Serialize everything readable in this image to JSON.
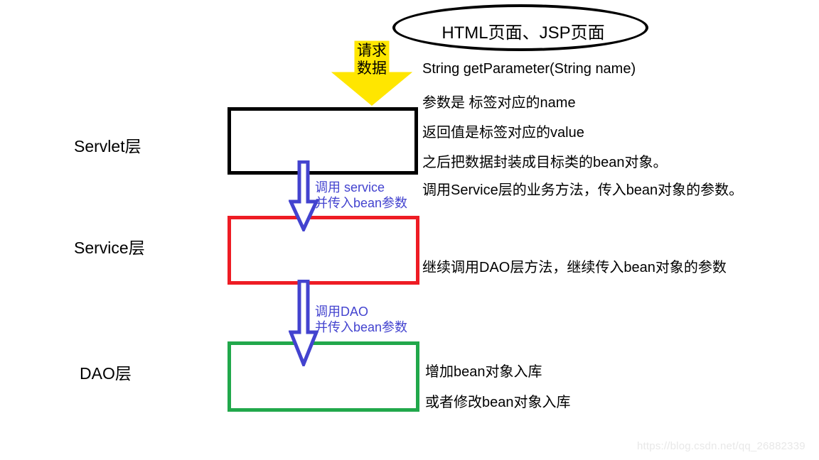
{
  "diagram": {
    "title_ellipse": {
      "label": "HTML页面、JSP页面",
      "icon": "ellipse-shape",
      "border_color": "#000000"
    },
    "request_arrow": {
      "icon": "down-arrow-icon",
      "fill_color": "#ffe600",
      "line1": "请求",
      "line2": "数据"
    },
    "layers": [
      {
        "name": "servlet",
        "label": "Servlet层",
        "box_color": "#000000"
      },
      {
        "name": "service",
        "label": "Service层",
        "box_color": "#ee1c24"
      },
      {
        "name": "dao",
        "label": "DAO层",
        "box_color": "#21a84b"
      }
    ],
    "call_arrows": [
      {
        "name": "servlet-to-service",
        "icon": "down-arrow-icon",
        "color": "#4343cf",
        "line1": "调用 service",
        "line2": "并传入bean参数"
      },
      {
        "name": "service-to-dao",
        "icon": "down-arrow-icon",
        "color": "#4343cf",
        "line1": "调用DAO",
        "line2": "并传入bean参数"
      }
    ],
    "notes": {
      "servlet": [
        "String   getParameter(String  name)",
        "参数是   标签对应的name",
        "返回值是标签对应的value",
        "之后把数据封装成目标类的bean对象。",
        "调用Service层的业务方法，传入bean对象的参数。"
      ],
      "service": [
        "继续调用DAO层方法，继续传入bean对象的参数"
      ],
      "dao": [
        "增加bean对象入库",
        "或者修改bean对象入库"
      ]
    },
    "watermark": "https://blog.csdn.net/qq_26882339"
  }
}
